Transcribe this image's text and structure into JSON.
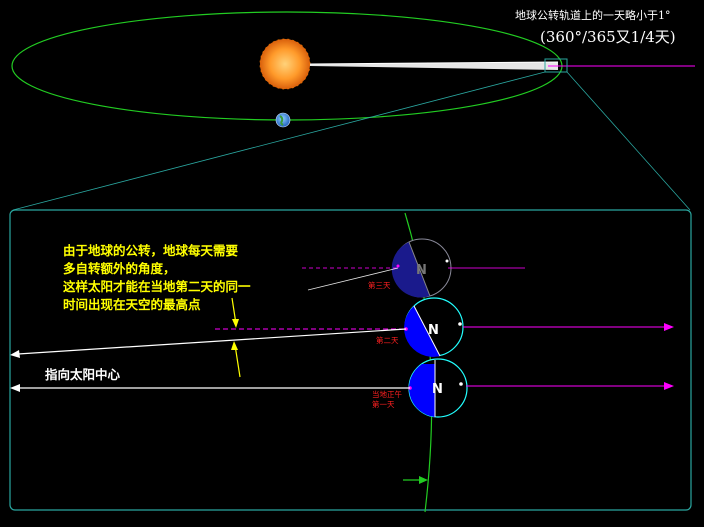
{
  "title": {
    "line1": "地球公转轨道上的一天略小于1°",
    "line2": "(360°/365又1/4天)"
  },
  "explanation": [
    "由于地球的公转，地球每天需要",
    "多自转额外的角度，",
    "这样太阳才能在当地第二天的同一",
    "时间出现在天空的最高点"
  ],
  "sun_direction_label": "指向太阳中心",
  "earth_labels": {
    "north": "N",
    "day3": "第三天",
    "day2": "第二天",
    "day1_line1": "当地正午",
    "day1_line2": "第一天"
  },
  "colors": {
    "orbit": "#22cc22",
    "zoom_frame": "#2aa7a0",
    "sun": "#ff8a1a",
    "earth_night": "#0000ff",
    "earth_outline_current": "#22ffff",
    "sun_ray": "#ff00ff",
    "text_highlight": "#ffff00",
    "day_label": "#ff2020"
  }
}
